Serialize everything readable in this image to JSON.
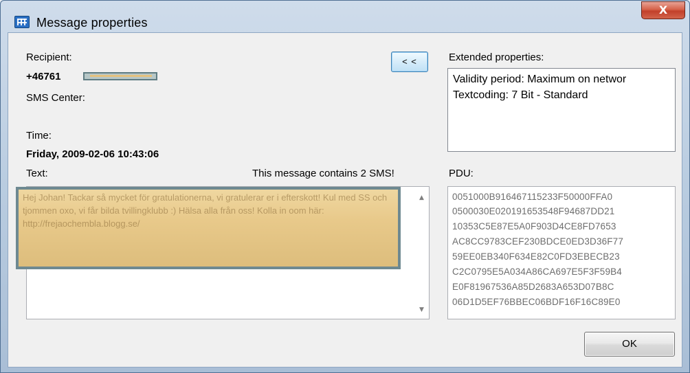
{
  "window": {
    "title": "Message properties",
    "close_label": "X"
  },
  "left": {
    "recipient_label": "Recipient:",
    "recipient_value": "+46761",
    "sms_center_label": "SMS Center:",
    "time_label": "Time:",
    "time_value": "Friday, 2009-02-06 10:43:06",
    "text_label": "Text:",
    "sms_count": "This message contains 2 SMS!",
    "message_text": "Hej Johan! Tackar så mycket för gratulationerna, vi gratulerar er i efterskott! Kul med SS och tjommen oxo, vi får bilda tvillingklubb :) Hälsa alla från oss! Kolla in oom här: http://frejaochembla.blogg.se/"
  },
  "collapse_button_label": "< <",
  "extended": {
    "label": "Extended properties:",
    "lines": [
      "Validity period: Maximum on networ",
      "Textcoding: 7 Bit - Standard"
    ]
  },
  "pdu": {
    "label": "PDU:",
    "lines": [
      "0051000B916467115233F50000FFA0",
      "0500030E020191653548F94687DD21",
      "10353C5E87E5A0F903D4CE8FD7653",
      "AC8CC9783CEF230BDCE0ED3D36F77",
      "59EE0EB340F634E82C0FD3EBECB23",
      "C2C0795E5A034A86CA697E5F3F59B4",
      "E0F81967536A85D2683A653D07B8C",
      "06D1D5EF76BBEC06BDF16F16C89E0"
    ]
  },
  "ok_label": "OK",
  "colors": {
    "close_button": "#c2402a",
    "button_border": "#3c7fb1",
    "redaction": "#e8c98a"
  },
  "icons": {
    "app": "grid-icon",
    "scroll_up": "▲",
    "scroll_down": "▼"
  }
}
